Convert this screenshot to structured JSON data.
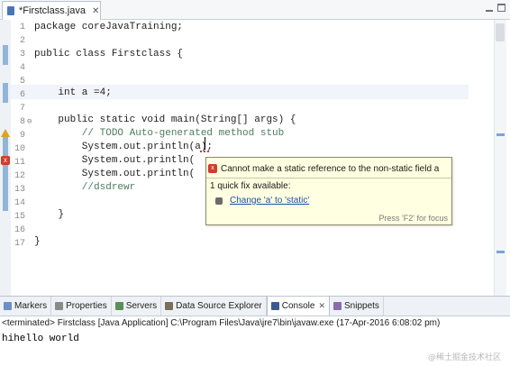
{
  "editor_tab": {
    "title": "*Firstclass.java",
    "close": "✕"
  },
  "line_numbers": [
    "1",
    "2",
    "3",
    "4",
    "5",
    "6",
    "7",
    "8",
    "9",
    "10",
    "11",
    "12",
    "13",
    "14",
    "15",
    "16",
    "17"
  ],
  "code": {
    "l1": "package coreJavaTraining;",
    "l3": "public class Firstclass {",
    "l6": "    int a =4;",
    "l8": "    public static void main(String[] args) {",
    "l9": "        // TODO Auto-generated method stub",
    "l10": "        System.out.println(a);",
    "l11": "        System.out.println(",
    "l12": "        System.out.println(",
    "l13": "        //dsdrewr",
    "l15": "    }",
    "l17": "}"
  },
  "quickfix": {
    "message": "Cannot make a static reference to the non-static field a",
    "count": "1 quick fix available:",
    "fix": "Change 'a' to 'static'",
    "status": "Press 'F2' for focus"
  },
  "panel": {
    "tabs": [
      {
        "label": "Markers",
        "icon_color": "#6b8fc7"
      },
      {
        "label": "Properties",
        "icon_color": "#8a8a8a"
      },
      {
        "label": "Servers",
        "icon_color": "#5a8f5a"
      },
      {
        "label": "Data Source Explorer",
        "icon_color": "#7a6f5a"
      },
      {
        "label": "Console",
        "icon_color": "#3c5a8c",
        "active": true
      },
      {
        "label": "Snippets",
        "icon_color": "#8a6bb0"
      }
    ],
    "terminated": "<terminated> Firstclass [Java Application] C:\\Program Files\\Java\\jre7\\bin\\javaw.exe (17-Apr-2016 6:08:02 pm)",
    "output": "hihello world",
    "watermark": "@稀土掘金技术社区"
  }
}
